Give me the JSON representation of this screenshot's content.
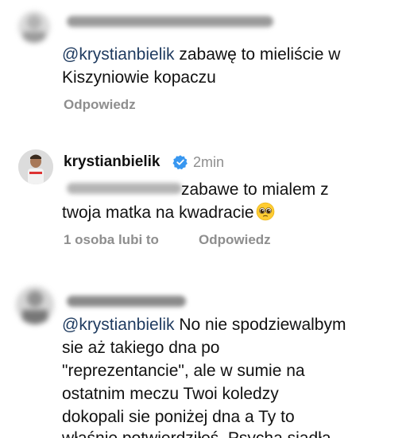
{
  "comment1": {
    "reply_text_mention": "@krystianbielik",
    "reply_text_rest": " zabawę to mieliście w",
    "reply_text_line2": "Kiszyniowie kopaczu",
    "reply_action": "Odpowiedz"
  },
  "comment2": {
    "username": "krystianbielik",
    "verified_icon": "verified-badge",
    "time": "2min",
    "text_line1_rest": " zabawe to mialem z",
    "text_line2": "twoja matka na kwadracie",
    "emoji": "pleading-face",
    "likes": "1 osoba lubi to",
    "reply_action": "Odpowiedz"
  },
  "comment3": {
    "mention": "@krystianbielik",
    "line1_rest": " No nie spodziewalbym",
    "line2": "sie aż takiego dna po",
    "line3": "\"reprezentancie\", ale w sumie na",
    "line4": "ostatnim meczu Twoi koledzy",
    "line5": "dokopali sie poniżej dna a Ty to",
    "line6": "właśnie potwierdziłeś. Psycha siadła"
  },
  "colors": {
    "text": "#111111",
    "muted": "#8e8e8e",
    "mention": "#1e3a5f",
    "verified": "#3897f0"
  }
}
